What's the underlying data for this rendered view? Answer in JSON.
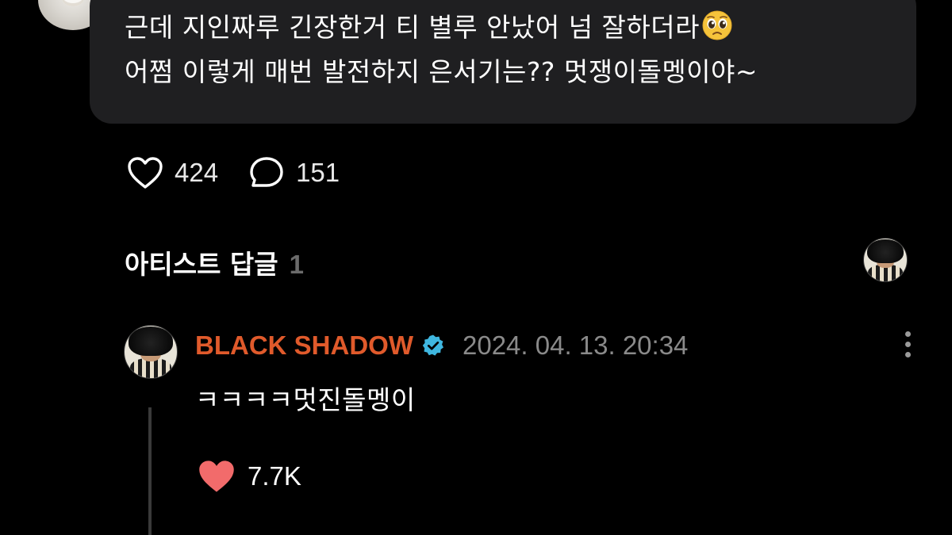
{
  "comment": {
    "text_line1": "근데 지인짜루 긴장한거 티 별루 안났어 넘 잘하더라",
    "emoji": "pleading-face-emoji",
    "text_line2": "어쩜 이렇게 매번 발전하지 은서기는?? 멋쟁이돌멩이야~",
    "likes": "424",
    "comments": "151"
  },
  "artist_replies": {
    "label": "아티스트 답글",
    "count": "1"
  },
  "reply": {
    "author": "BLACK SHADOW",
    "timestamp": "2024. 04. 13. 20:34",
    "text": "ㅋㅋㅋㅋ멋진돌멩이",
    "likes": "7.7K"
  },
  "colors": {
    "background": "#000000",
    "bubble": "#1f1f21",
    "author": "#e05a2b",
    "verified": "#3fb7e0",
    "heart_filled": "#f26b6b",
    "muted_text": "#8a8a8a"
  }
}
